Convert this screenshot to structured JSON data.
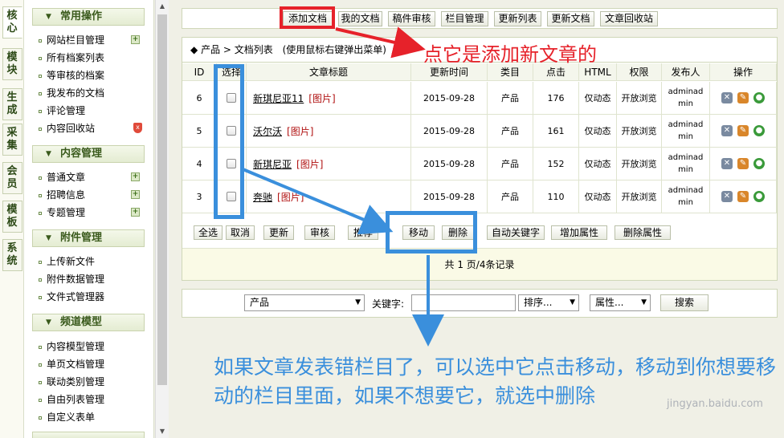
{
  "left_tabs": [
    "核心",
    "模块",
    "生成",
    "采集",
    "会员",
    "模板",
    "系统"
  ],
  "sidebar": {
    "sections": [
      {
        "title": "常用操作",
        "items": [
          "网站栏目管理",
          "所有档案列表",
          "等审核的档案",
          "我发布的文档",
          "评论管理",
          "内容回收站"
        ]
      },
      {
        "title": "内容管理",
        "items": [
          "普通文章",
          "招聘信息",
          "专题管理"
        ]
      },
      {
        "title": "附件管理",
        "items": [
          "上传新文件",
          "附件数据管理",
          "文件式管理器"
        ]
      },
      {
        "title": "频道模型",
        "items": [
          "内容模型管理",
          "单页文档管理",
          "联动类别管理",
          "自由列表管理",
          "自定义表单"
        ]
      }
    ]
  },
  "toolbar": [
    "添加文档",
    "我的文档",
    "稿件审核",
    "栏目管理",
    "更新列表",
    "更新文档",
    "文章回收站"
  ],
  "breadcrumb": {
    "bullet": "◆",
    "path": "产品 > 文档列表",
    "hint": "(使用鼠标右键弹出菜单)"
  },
  "table": {
    "headers": [
      "ID",
      "选择",
      "文章标题",
      "更新时间",
      "类目",
      "点击",
      "HTML",
      "权限",
      "发布人",
      "操作"
    ],
    "rows": [
      {
        "id": "6",
        "title": "新琪尼亚11",
        "tag": "[图片]",
        "date": "2015-09-28",
        "category": "产品",
        "clicks": "176",
        "html": "仅动态",
        "perm": "开放浏览",
        "publisher": "adminadmin"
      },
      {
        "id": "5",
        "title": "沃尔沃",
        "tag": "[图片]",
        "date": "2015-09-28",
        "category": "产品",
        "clicks": "161",
        "html": "仅动态",
        "perm": "开放浏览",
        "publisher": "adminadmin"
      },
      {
        "id": "4",
        "title": "新琪尼亚",
        "tag": "[图片]",
        "date": "2015-09-28",
        "category": "产品",
        "clicks": "152",
        "html": "仅动态",
        "perm": "开放浏览",
        "publisher": "adminadmin"
      },
      {
        "id": "3",
        "title": "奔驰",
        "tag": "[图片]",
        "date": "2015-09-28",
        "category": "产品",
        "clicks": "110",
        "html": "仅动态",
        "perm": "开放浏览",
        "publisher": "adminadmin"
      }
    ]
  },
  "actions": [
    "全选",
    "取消",
    "更新",
    "审核",
    "推荐",
    "移动",
    "删除",
    "自动关键字",
    "增加属性",
    "删除属性"
  ],
  "pager": "共 1 页/4条记录",
  "search": {
    "category": "产品",
    "keyword_label": "关键字:",
    "sort": "排序...",
    "attr": "属性...",
    "button": "搜索"
  },
  "annotations": {
    "red": "点它是添加新文章的",
    "blue": "如果文章发表错栏目了，可以选中它点击移动，移动到你想要移动的栏目里面，如果不想要它，就选中删除"
  },
  "watermark": "jingyan.baidu.com",
  "colors": {
    "annotation_red": "#e6222a",
    "annotation_blue": "#3a8fdc",
    "section_green": "#3a5a1c"
  }
}
